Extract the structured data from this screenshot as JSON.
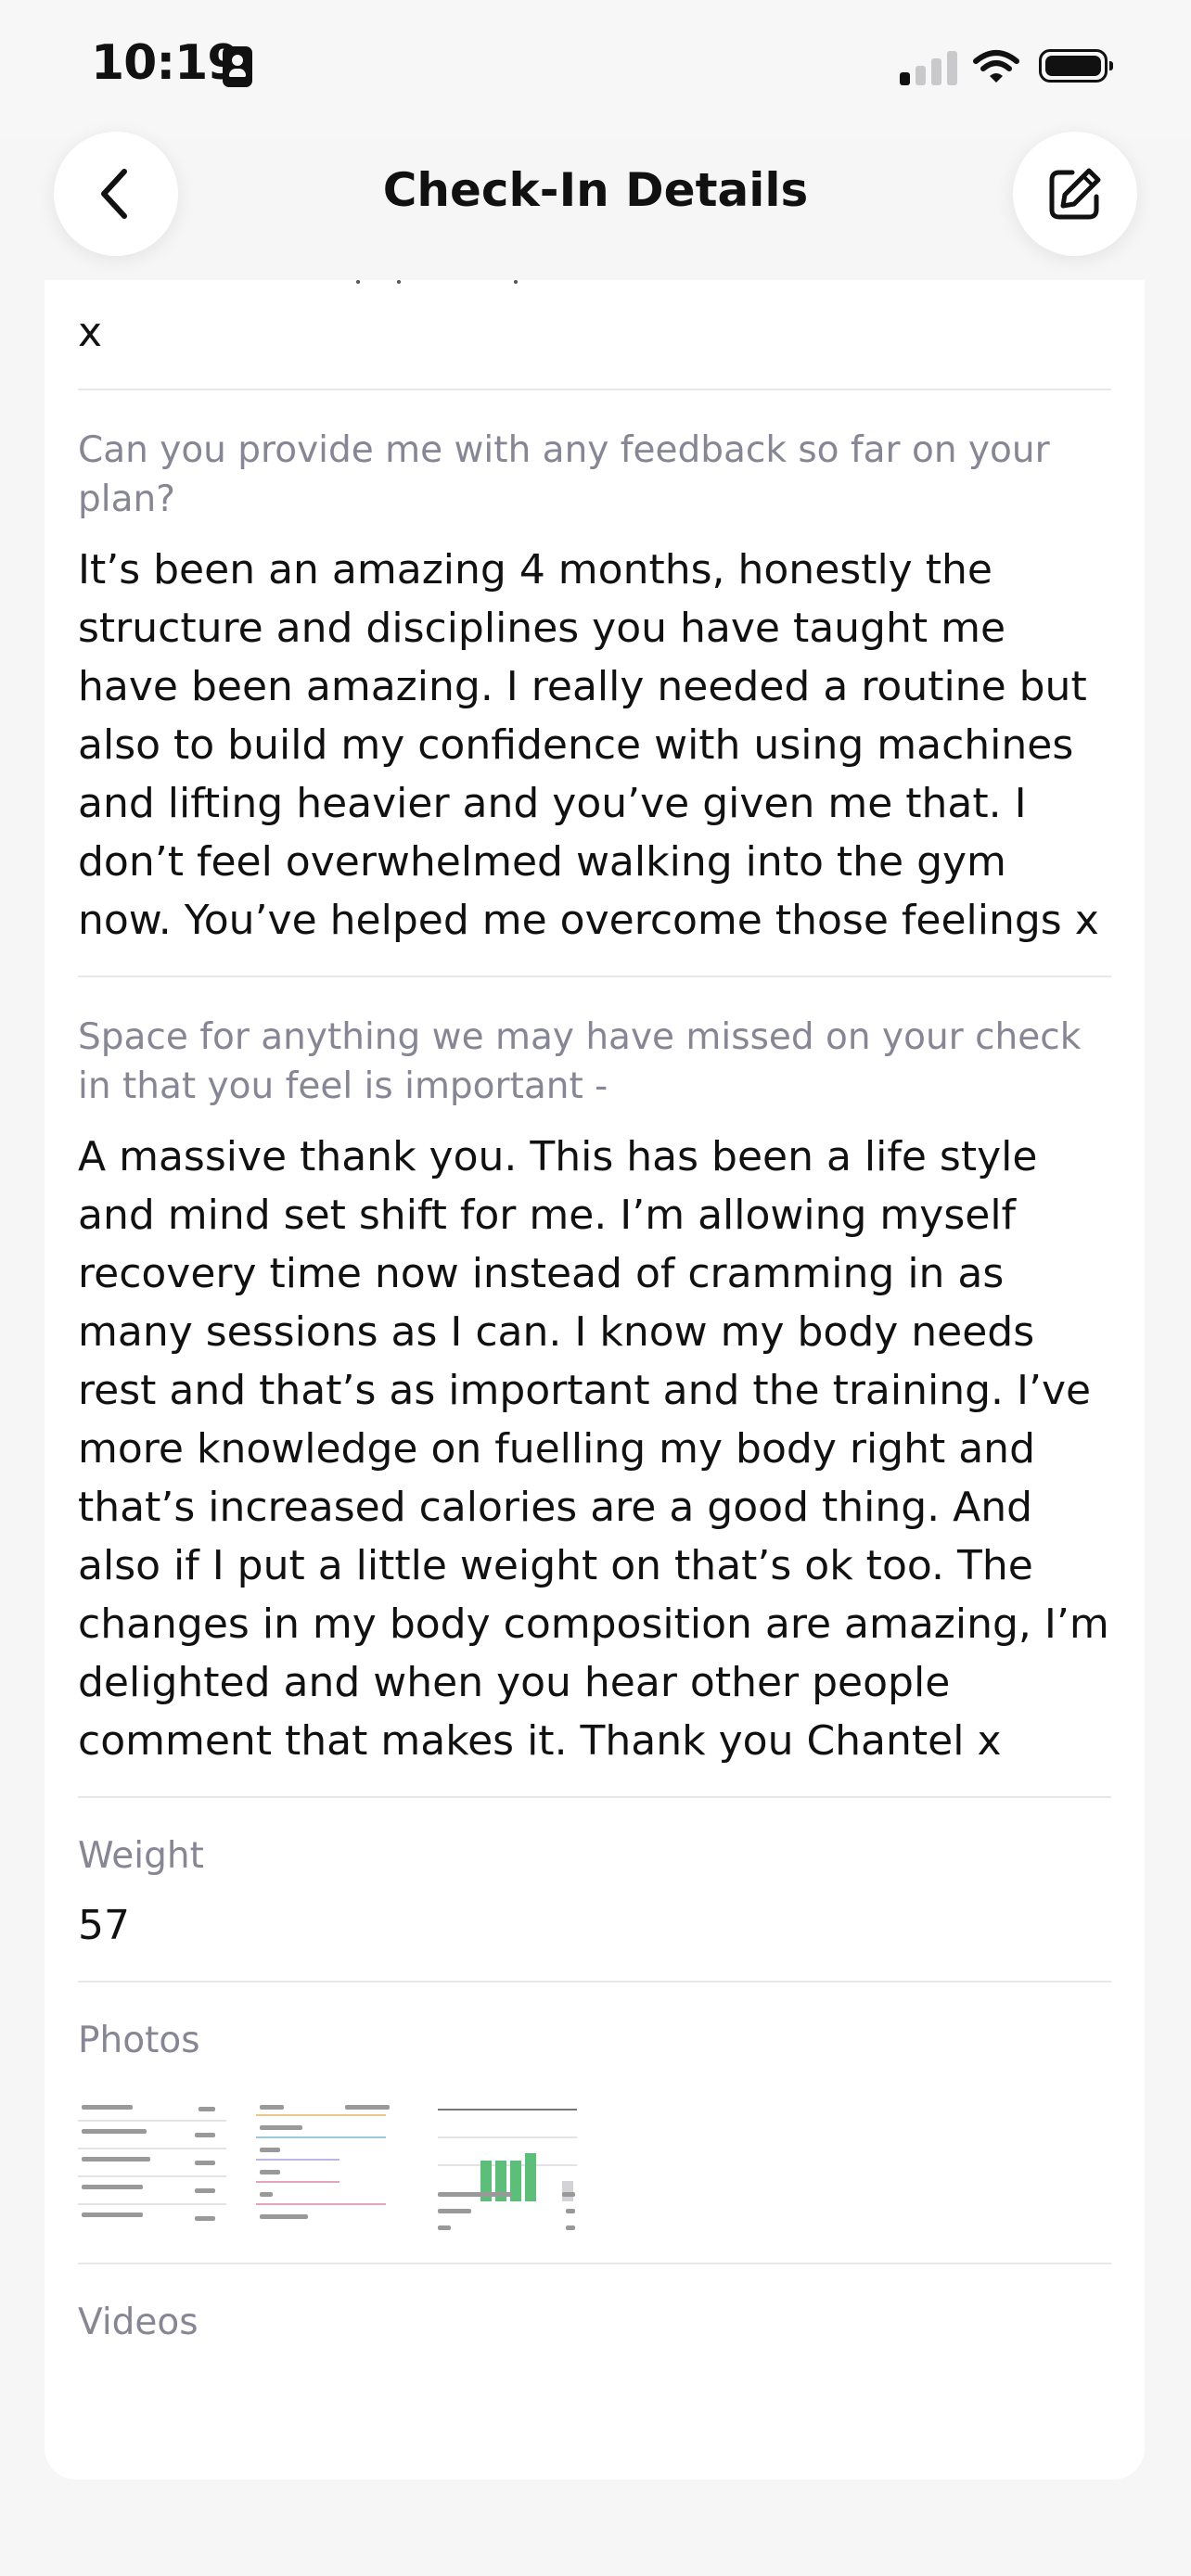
{
  "status_bar": {
    "time": "10:19",
    "icons": [
      "person-badge-icon",
      "cellular-signal-icon",
      "wifi-icon",
      "battery-icon"
    ]
  },
  "nav": {
    "title": "Check-In Details",
    "back_icon": "chevron-left-icon",
    "edit_icon": "edit-square-pen-icon"
  },
  "content": {
    "previous_answer": "x",
    "items": [
      {
        "question": "Can you provide me with any feedback so far on your plan?",
        "answer": "It’s been an amazing 4 months, honestly the structure and disciplines you have taught me have been amazing. I really needed a routine but also to build my confidence with using machines and lifting heavier and you’ve given me that. I don’t feel overwhelmed walking into the gym now. You’ve helped me overcome those feelings x"
      },
      {
        "question": "Space for anything we may have missed on your check in that you feel is important -",
        "answer": "A massive thank you. This has been a life style and mind set shift for me. I’m allowing myself recovery time now instead of cramming in as many sessions as I can. I know my body needs rest and that’s as important and the training. I’ve more knowledge on fuelling my body right and that’s increased calories are a good thing. And also if I put a little weight on that’s ok too. The changes in my body composition are amazing, I’m delighted and when you hear other people comment that makes it. Thank you Chantel x"
      }
    ],
    "weight": {
      "label": "Weight",
      "value": "57"
    },
    "photos": {
      "label": "Photos",
      "count": 3
    },
    "videos": {
      "label": "Videos"
    }
  },
  "colors": {
    "background": "#f6f6f7",
    "card": "#ffffff",
    "label_gray": "#868695",
    "divider": "#e8e8ec",
    "chart_green": "#5bbe79"
  }
}
